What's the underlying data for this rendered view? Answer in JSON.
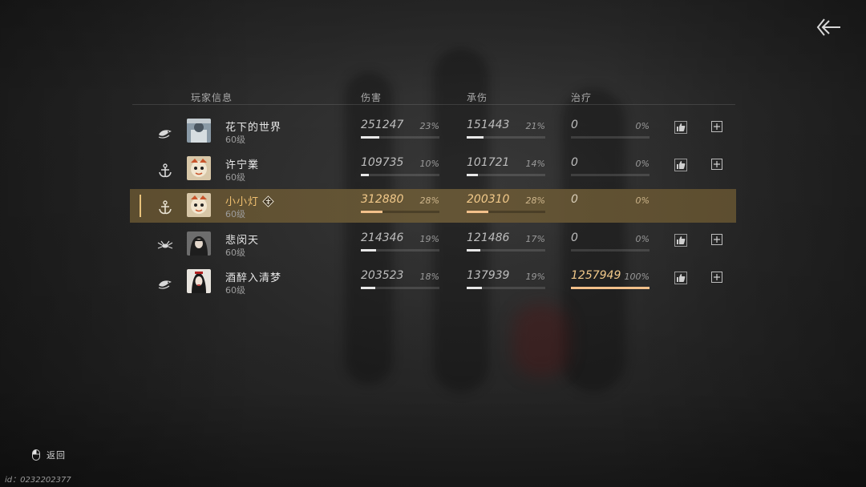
{
  "header": {
    "player_info": "玩家信息",
    "damage": "伤害",
    "damage_taken": "承伤",
    "healing": "治疗"
  },
  "players": [
    {
      "class_icon": "fish-class-icon",
      "name": "花下的世界",
      "level": "60级",
      "damage": {
        "value": "251247",
        "pct": "23%",
        "ratio": 0.23
      },
      "taken": {
        "value": "151443",
        "pct": "21%",
        "ratio": 0.21
      },
      "heal": {
        "value": "0",
        "pct": "0%",
        "ratio": 0
      },
      "self": false
    },
    {
      "class_icon": "anchor-class-icon",
      "name": "许宁業",
      "level": "60级",
      "damage": {
        "value": "109735",
        "pct": "10%",
        "ratio": 0.1
      },
      "taken": {
        "value": "101721",
        "pct": "14%",
        "ratio": 0.14
      },
      "heal": {
        "value": "0",
        "pct": "0%",
        "ratio": 0
      },
      "self": false
    },
    {
      "class_icon": "anchor-class-icon",
      "name": "小小灯",
      "level": "60级",
      "damage": {
        "value": "312880",
        "pct": "28%",
        "ratio": 0.28
      },
      "taken": {
        "value": "200310",
        "pct": "28%",
        "ratio": 0.28
      },
      "heal": {
        "value": "0",
        "pct": "0%",
        "ratio": 0
      },
      "self": true
    },
    {
      "class_icon": "spider-class-icon",
      "name": "悲闵天",
      "level": "60级",
      "damage": {
        "value": "214346",
        "pct": "19%",
        "ratio": 0.19
      },
      "taken": {
        "value": "121486",
        "pct": "17%",
        "ratio": 0.17
      },
      "heal": {
        "value": "0",
        "pct": "0%",
        "ratio": 0
      },
      "self": false
    },
    {
      "class_icon": "fish-class-icon",
      "name": "酒醉入清梦",
      "level": "60级",
      "damage": {
        "value": "203523",
        "pct": "18%",
        "ratio": 0.18
      },
      "taken": {
        "value": "137939",
        "pct": "19%",
        "ratio": 0.19
      },
      "heal": {
        "value": "1257949",
        "pct": "100%",
        "ratio": 1.0,
        "highlight": true
      },
      "self": false
    }
  ],
  "footer": {
    "back_label": "返回",
    "id_text": "id：0232202377"
  },
  "colors": {
    "accent": "#f2c08a",
    "self_row": "#605030",
    "bar_fill": "#e8e8e8"
  }
}
